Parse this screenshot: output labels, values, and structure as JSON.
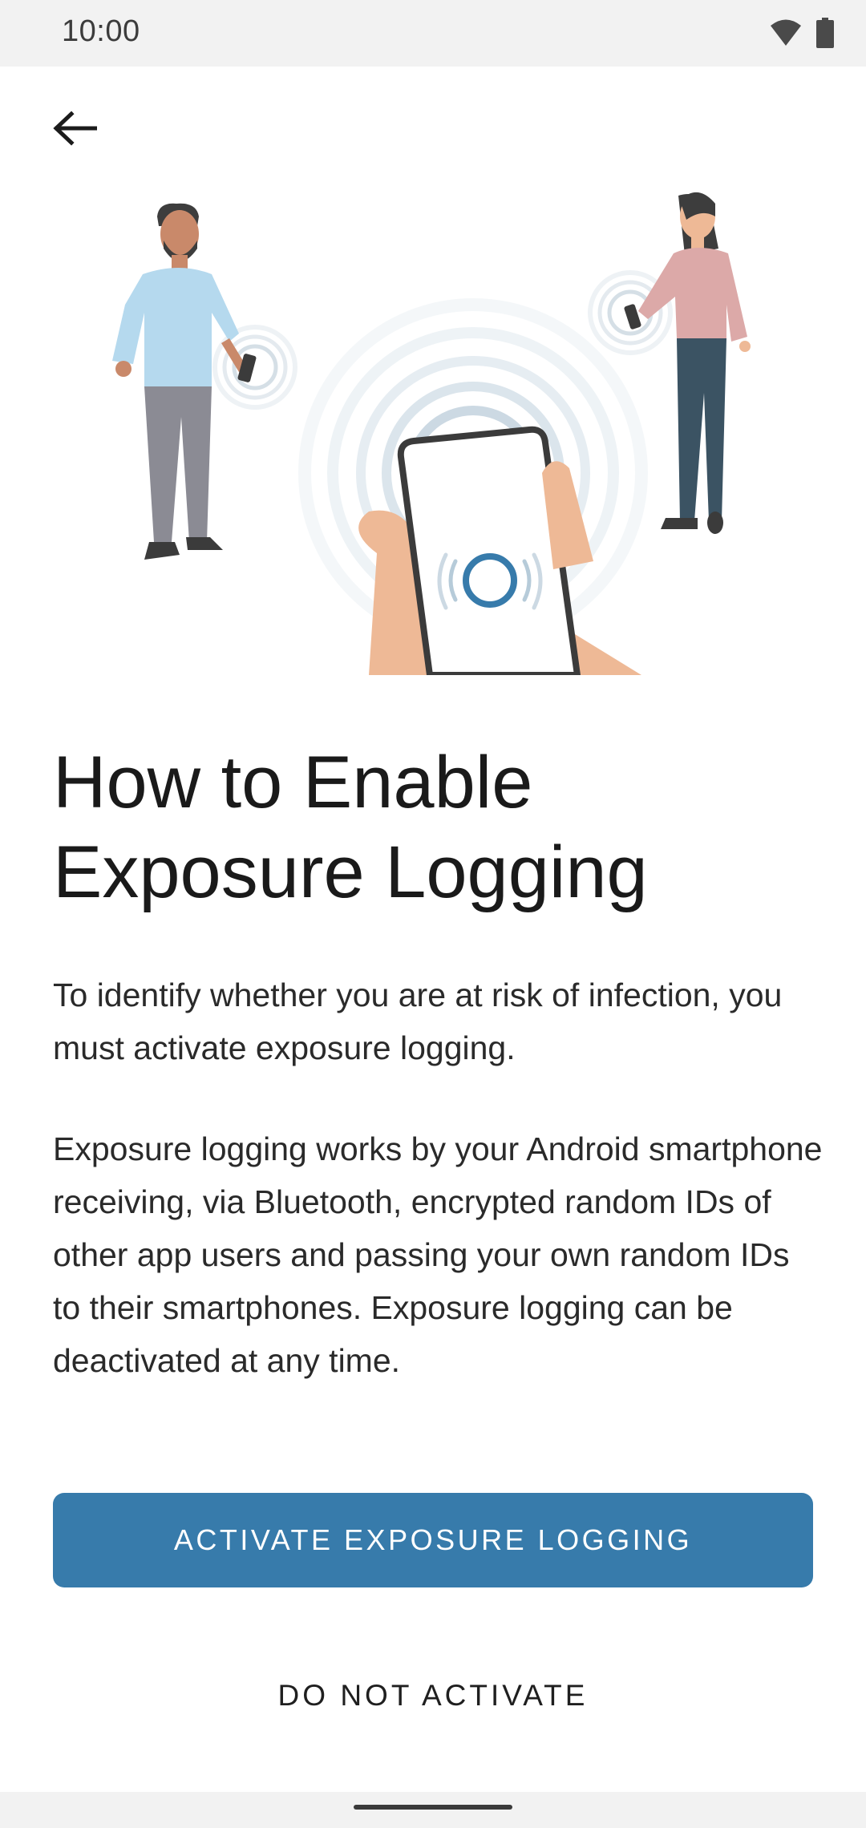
{
  "status_bar": {
    "time": "10:00",
    "icons": [
      "wifi-icon",
      "battery-icon"
    ]
  },
  "toolbar": {
    "back_icon": "arrow-back-icon"
  },
  "illustration": {
    "name": "people-exchanging-ids-illustration",
    "colors": {
      "man_shirt": "#b5d9ee",
      "man_pants": "#8b8b94",
      "woman_top": "#dca9a8",
      "woman_pants": "#3b5363",
      "skin": "#eeb996",
      "ring_blue": "#377bab"
    }
  },
  "content": {
    "title_line1": "How to Enable",
    "title_line2": "Exposure Logging",
    "paragraph1": "To identify whether you are at risk of infection, you must activate exposure logging.",
    "paragraph2": "Exposure logging works by your Android smartphone receiving, via Bluetooth, encrypted random IDs of other app users and passing your own random IDs to their smartphones. Exposure logging can be deactivated at any time."
  },
  "actions": {
    "activate_label": "ACTIVATE EXPOSURE LOGGING",
    "decline_label": "DO NOT ACTIVATE"
  },
  "colors": {
    "accent": "#377bab",
    "status_bar_bg": "#f2f2f2"
  }
}
